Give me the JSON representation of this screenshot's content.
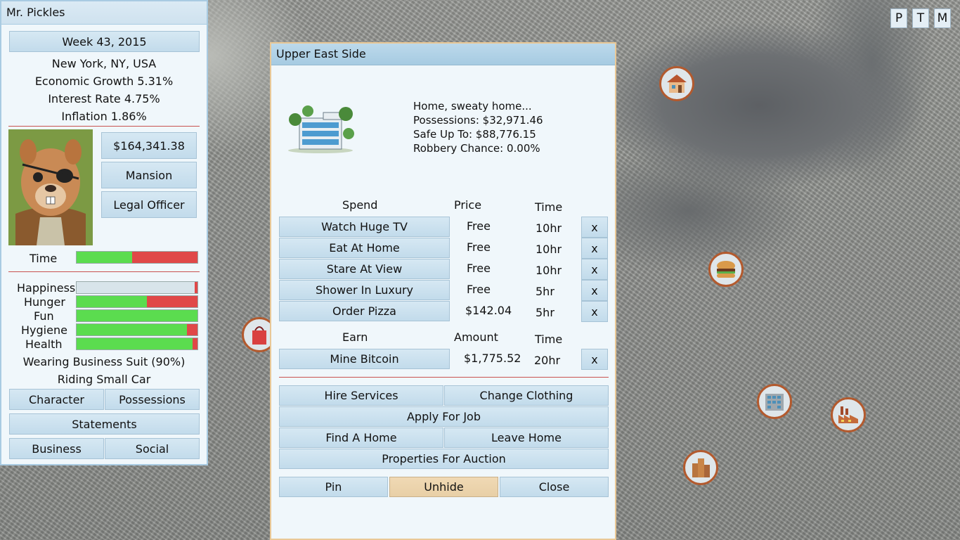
{
  "corner_buttons": [
    "P",
    "T",
    "M"
  ],
  "left_panel": {
    "title": "Mr. Pickles",
    "date": "Week 43, 2015",
    "location": "New York, NY, USA",
    "economic_growth": "Economic Growth 5.31%",
    "interest_rate": "Interest Rate 4.75%",
    "inflation": "Inflation 1.86%",
    "money": "$164,341.38",
    "residence": "Mansion",
    "job": "Legal Officer",
    "time_label": "Time",
    "time_progress": 0.46,
    "stats": [
      {
        "label": "Happiness",
        "value": 0.0
      },
      {
        "label": "Hunger",
        "value": 0.58
      },
      {
        "label": "Fun",
        "value": 1.0
      },
      {
        "label": "Hygiene",
        "value": 0.91
      },
      {
        "label": "Health",
        "value": 0.96
      }
    ],
    "wearing": "Wearing Business Suit (90%)",
    "riding": "Riding Small Car",
    "buttons": {
      "character": "Character",
      "possessions": "Possessions",
      "statements": "Statements",
      "business": "Business",
      "social": "Social"
    }
  },
  "dialog": {
    "title": "Upper East Side",
    "desc": [
      "Home, sweaty home...",
      "Possessions: $32,971.46",
      "Safe Up To: $88,776.15",
      "Robbery Chance: 0.00%"
    ],
    "spend_headers": {
      "action": "Spend",
      "price": "Price",
      "time": "Time"
    },
    "spend_rows": [
      {
        "action": "Watch Huge TV",
        "price": "Free",
        "time": "10hr",
        "x": "x"
      },
      {
        "action": "Eat At Home",
        "price": "Free",
        "time": "10hr",
        "x": "x"
      },
      {
        "action": "Stare At View",
        "price": "Free",
        "time": "10hr",
        "x": "x"
      },
      {
        "action": "Shower In Luxury",
        "price": "Free",
        "time": "5hr",
        "x": "x"
      },
      {
        "action": "Order Pizza",
        "price": "$142.04",
        "time": "5hr",
        "x": "x"
      }
    ],
    "earn_headers": {
      "action": "Earn",
      "amount": "Amount",
      "time": "Time"
    },
    "earn_rows": [
      {
        "action": "Mine Bitcoin",
        "amount": "$1,775.52",
        "time": "20hr",
        "x": "x"
      }
    ],
    "buttons": {
      "hire_services": "Hire Services",
      "change_clothing": "Change Clothing",
      "apply_for_job": "Apply For Job",
      "find_a_home": "Find A Home",
      "leave_home": "Leave Home",
      "properties_for_auction": "Properties For Auction",
      "pin": "Pin",
      "unhide": "Unhide",
      "close": "Close"
    }
  },
  "colors": {
    "bar_green": "#5bdc4f",
    "bar_red": "#e04848",
    "panel_bg": "#f0f7fb",
    "button_blue": "#c2dbeb",
    "unhide_tan": "#e8cfa6",
    "divider_red": "#c9524f"
  },
  "map_markers": [
    "house-marker-icon",
    "burger-marker-icon",
    "apartment-marker-icon",
    "factory-marker-icon",
    "office-tower-marker-icon",
    "shopping-bag-marker-icon"
  ]
}
